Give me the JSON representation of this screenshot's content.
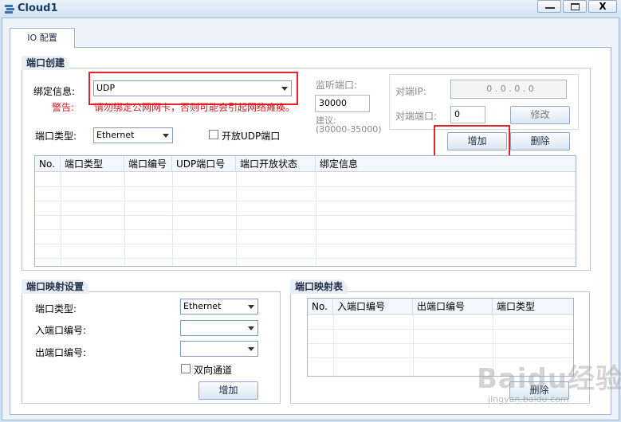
{
  "window": {
    "title": "Cloud1",
    "minimize": "—",
    "maximize": "☐",
    "close": "X"
  },
  "tabs": [
    {
      "label": "IO 配置"
    }
  ],
  "port_create": {
    "legend": "端口创建",
    "bind_label": "绑定信息:",
    "bind_value": "UDP",
    "warning_label": "警告:",
    "warning_text": "请勿绑定公网网卡，否则可能会引起网络瘫痪。",
    "port_type_label": "端口类型:",
    "port_type_value": "Ethernet",
    "open_udp_label": "开放UDP端口",
    "listen_port_label": "监听端口:",
    "listen_port_value": "30000",
    "suggest_label": "建议:",
    "suggest_range": "(30000-35000)",
    "peer_ip_label": "对端IP:",
    "peer_ip_value": "0  .  0  .  0  .  0",
    "peer_port_label": "对端端口:",
    "peer_port_value": "0",
    "modify_button": "修改",
    "add_button": "增加",
    "delete_button": "删除",
    "table_headers": [
      "No.",
      "端口类型",
      "端口编号",
      "UDP端口号",
      "端口开放状态",
      "绑定信息"
    ]
  },
  "port_mapping": {
    "legend": "端口映射设置",
    "port_type_label": "端口类型:",
    "port_type_value": "Ethernet",
    "in_port_label": "入端口编号:",
    "out_port_label": "出端口编号:",
    "bidirectional_label": "双向通道",
    "add_button": "增加"
  },
  "mapping_table": {
    "legend": "端口映射表",
    "headers": [
      "No.",
      "入端口编号",
      "出端口编号",
      "端口类型"
    ],
    "delete_button": "删除"
  },
  "watermark": {
    "text": "Baidu经验",
    "subtext": "jingyan.baidu.com"
  },
  "colors": {
    "highlight": "#e0242a",
    "warning": "#d0191f"
  }
}
